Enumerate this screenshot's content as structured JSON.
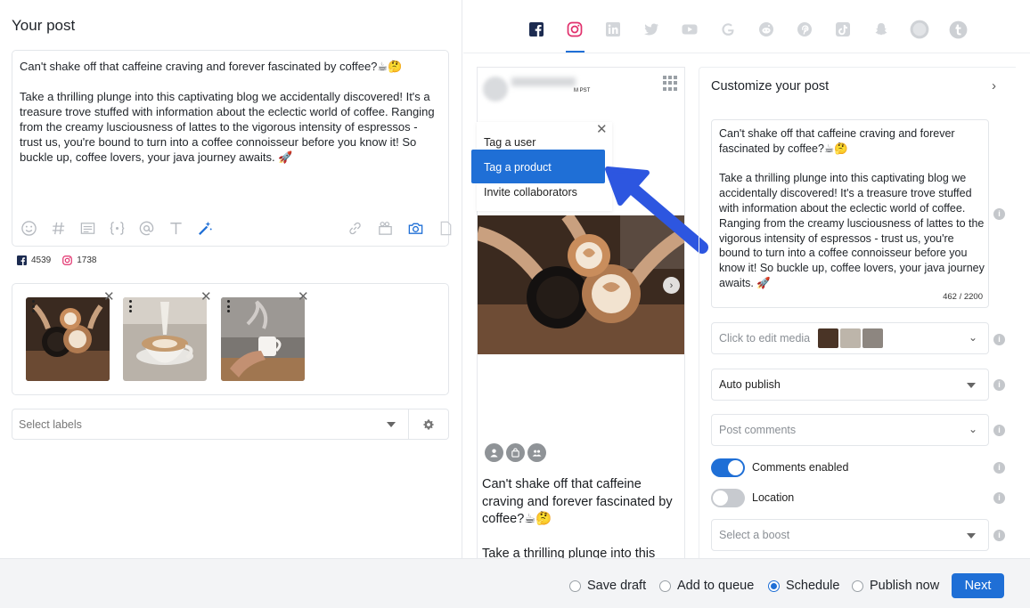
{
  "left": {
    "title": "Your post",
    "post_text": "Can't shake off that caffeine craving and forever fascinated by coffee?☕🤔\n\nTake a thrilling plunge into this captivating blog we accidentally discovered! It's a treasure trove stuffed with information about the eclectic world of coffee. Ranging from the creamy lusciousness of lattes to the vigorous intensity of espressos - trust us, you're bound to turn into a coffee connoisseur before you know it! So buckle up, coffee lovers, your java journey awaits. 🚀",
    "toolbar_icons": [
      "emoji-icon",
      "hashtag-icon",
      "template-icon",
      "variable-icon",
      "mention-icon",
      "text-format-icon",
      "magic-wand-icon",
      "link-icon",
      "video-icon",
      "camera-icon",
      "document-icon"
    ],
    "counts": [
      {
        "network": "facebook",
        "value": "4539",
        "icon": "facebook-icon"
      },
      {
        "network": "instagram",
        "value": "1738",
        "icon": "instagram-icon"
      }
    ],
    "labels_placeholder": "Select labels"
  },
  "network_tabs": [
    "facebook",
    "instagram",
    "linkedin",
    "twitter",
    "youtube",
    "google",
    "reddit",
    "pinterest",
    "tiktok",
    "snapchat",
    "avatar",
    "tumblr"
  ],
  "preview": {
    "time_label": "M PST",
    "caption": "Can't shake off that caffeine craving and forever fascinated by coffee?☕🤔\n\nTake a thrilling plunge into this"
  },
  "tag_menu": {
    "items": [
      "Tag a user",
      "Tag a product",
      "Invite collaborators"
    ],
    "active": "Tag a product"
  },
  "customize": {
    "title": "Customize your post",
    "text": "Can't shake off that caffeine craving and forever fascinated by coffee?☕🤔\n\nTake a thrilling plunge into this captivating blog we accidentally discovered! It's a treasure trove stuffed with information about the eclectic world of coffee. Ranging from the creamy lusciousness of lattes to the vigorous intensity of espressos - trust us, you're bound to turn into a coffee connoisseur before you know it! So buckle up, coffee lovers, your java journey awaits. 🚀",
    "char_count": "462 / 2200",
    "edit_media_label": "Click to edit media",
    "publish_mode": "Auto publish",
    "post_comments_placeholder": "Post comments",
    "comments_label": "Comments enabled",
    "comments_enabled": true,
    "location_label": "Location",
    "location_enabled": false,
    "boost_placeholder": "Select a boost"
  },
  "footer": {
    "options": [
      "Save draft",
      "Add to queue",
      "Schedule",
      "Publish now"
    ],
    "selected": "Schedule",
    "next_label": "Next"
  },
  "colors": {
    "accent": "#1f6fd6",
    "facebook": "#1c2b50",
    "instagram": "#e1306c"
  }
}
